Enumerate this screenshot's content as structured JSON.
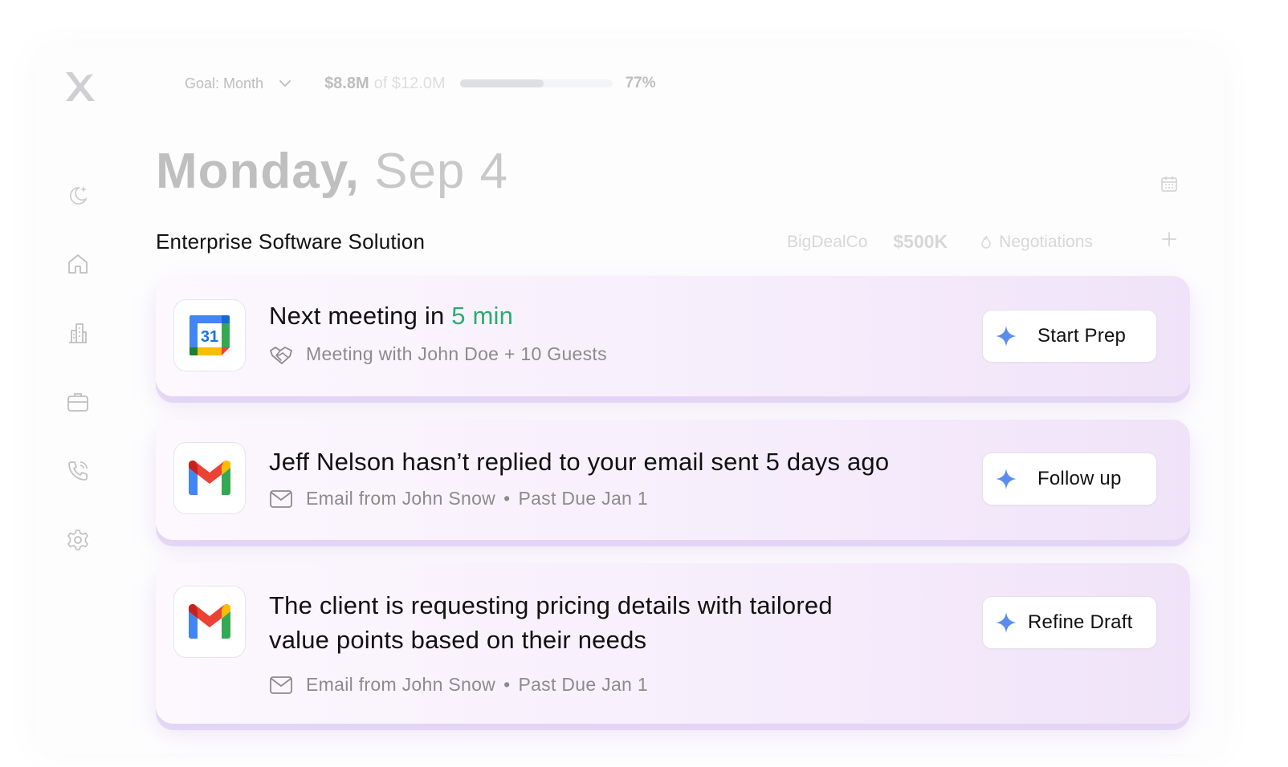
{
  "goal": {
    "label": "Goal: Month",
    "amount": "$8.8M",
    "of_target": "of $12.0M",
    "progress": 0.55,
    "percent": "77%"
  },
  "sidebar": {
    "items": [
      {
        "icon": "moon-sparkle-icon",
        "active": false
      },
      {
        "icon": "home-icon",
        "active": false
      },
      {
        "icon": "building-icon",
        "active": false
      },
      {
        "icon": "briefcase-icon",
        "active": false
      },
      {
        "icon": "phone-call-icon",
        "active": false
      },
      {
        "icon": "gear-icon",
        "active": false
      }
    ]
  },
  "header": {
    "weekday": "Monday,",
    "date": "Sep 4"
  },
  "deal": {
    "title": "Enterprise Software Solution",
    "company": "BigDealCo",
    "value": "$500K",
    "stage": "Negotiations"
  },
  "cards": [
    {
      "app": "google-calendar-icon",
      "calendar_day": "31",
      "title_prefix": "Next meeting in ",
      "title_highlight": "5 min",
      "sub_icon": "handshake-icon",
      "subtitle": "Meeting with John Doe + 10 Guests",
      "action": "Start Prep"
    },
    {
      "app": "gmail-icon",
      "title": "Jeff Nelson hasn’t replied to your email sent 5 days ago",
      "sub_icon": "mail-icon",
      "sub_from": "Email from John Snow",
      "sub_due": "Past Due Jan 1",
      "action": "Follow up"
    },
    {
      "app": "gmail-icon",
      "title_line1": "The client is requesting pricing details with tailored",
      "title_line2": "value points based on their needs",
      "sub_icon": "mail-icon",
      "sub_from": "Email from John Snow",
      "sub_due": "Past Due Jan 1",
      "action": "Refine Draft"
    }
  ],
  "colors": {
    "accent_green": "#2eab6e",
    "sparkle_blue": "#5b8def",
    "card_tint": "#f3e8fb"
  }
}
